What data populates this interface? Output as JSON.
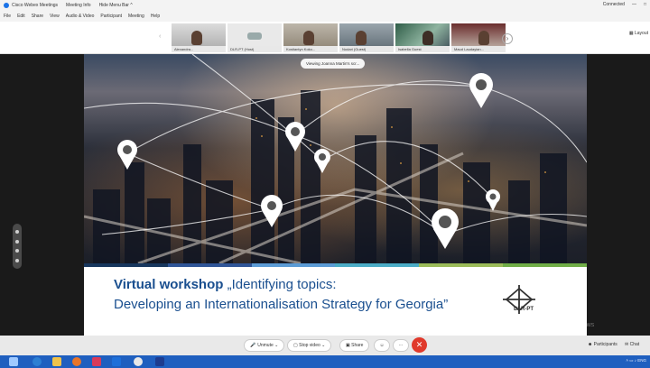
{
  "window": {
    "title": "Cisco Webex Meetings",
    "tabs": [
      "Meeting Info",
      "Hide Menu Bar ^"
    ],
    "status": "Connected",
    "controls": [
      "—",
      "□"
    ]
  },
  "menu": [
    "File",
    "Edit",
    "Share",
    "View",
    "Audio & Video",
    "Participant",
    "Meeting",
    "Help"
  ],
  "participants": [
    {
      "name": "Alexandra..."
    },
    {
      "name": "DLR-PT (Host)"
    },
    {
      "name": "Kostiantyn Koko..."
    },
    {
      "name": "Nodari (Guest)"
    },
    {
      "name": "Isabella Guest"
    },
    {
      "name": "Maud Laudayian..."
    }
  ],
  "layout_button": "Layout",
  "viewing_badge": "Viewing Joanna Martin's scr...",
  "slide": {
    "title_bold": "Virtual workshop",
    "title_rest": " „Identifying topics:",
    "subtitle": "Developing an Internationalisation Strategy for Georgia”",
    "logo_text": "DLR-PT",
    "band_colors": [
      "#17365d",
      "#2f5597",
      "#5b9bd5",
      "#4bacc6",
      "#9bbb59",
      "#70ad47"
    ]
  },
  "watermark": "Activate Windows",
  "controls": {
    "mute": "Unmute",
    "video": "Stop video",
    "share": "Share",
    "more": "···",
    "end": "✕",
    "participants": "Participants",
    "chat": "Chat"
  },
  "taskbar": {
    "tray_text": "˄ ▭ ♪ ENG",
    "colors": {
      "bar": "#1f5fbf",
      "accent": "#e0392b"
    }
  }
}
